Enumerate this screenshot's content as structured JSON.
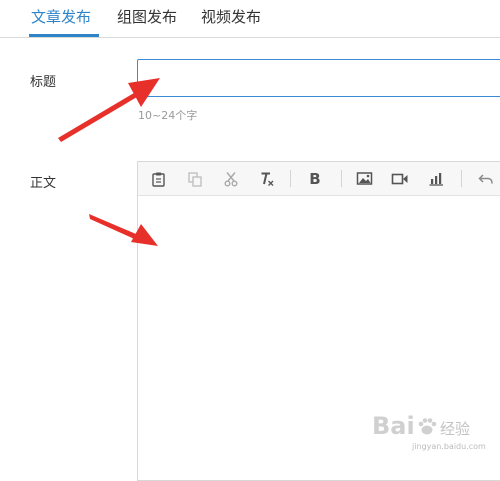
{
  "tabs": [
    {
      "label": "文章发布",
      "active": true
    },
    {
      "label": "组图发布",
      "active": false
    },
    {
      "label": "视频发布",
      "active": false
    }
  ],
  "form": {
    "title_label": "标题",
    "title_value": "",
    "title_hint": "10~24个字",
    "body_label": "正文"
  },
  "toolbar": {
    "icons": [
      "paste-icon",
      "copy-icon",
      "cut-icon",
      "clear-format-icon",
      "bold-icon",
      "image-icon",
      "video-icon",
      "chart-icon",
      "undo-icon"
    ],
    "bold_glyph": "B"
  },
  "watermark": {
    "text": "Bai",
    "suffix": "经验",
    "domain": "jingyan.baidu.com"
  },
  "colors": {
    "accent": "#2f83c9",
    "arrow": "#e8302b",
    "icon": "#555555",
    "icon_disabled": "#bdbdbd"
  }
}
